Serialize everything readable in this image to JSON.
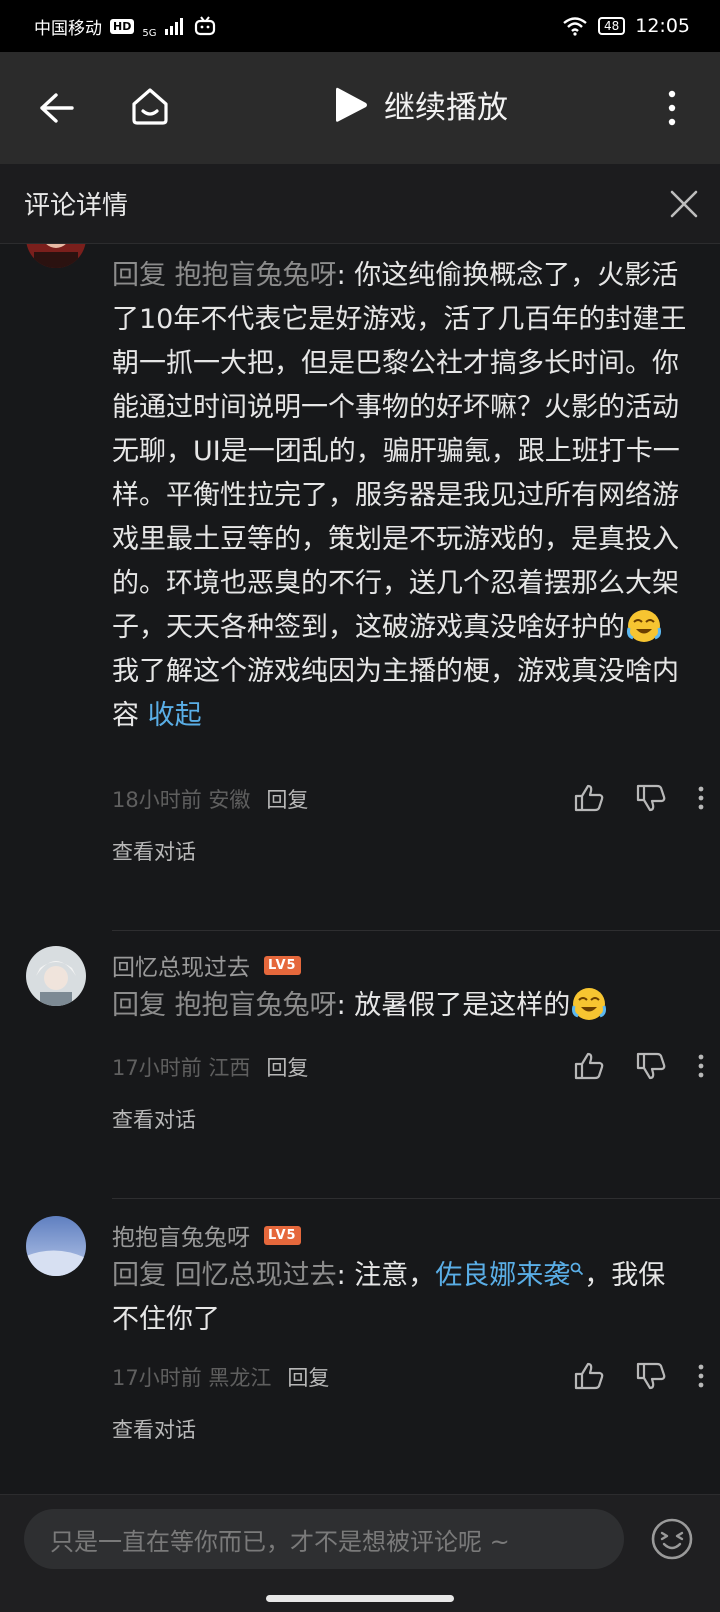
{
  "status_bar": {
    "carrier": "中国移动",
    "hd": "HD",
    "network": "5G",
    "battery": "48",
    "time": "12:05"
  },
  "top_bar": {
    "continue_label": "继续播放"
  },
  "detail_header": {
    "title": "评论详情"
  },
  "comments": [
    {
      "reply_prefix": "回复 ",
      "reply_target": "抱抱盲兔兔呀",
      "text_1": ": 你这纯偷换概念了，火影活了10年不代表它是好游戏，活了几百年的封建王朝一抓一大把，但是巴黎公社才搞多长时间。你能通过时间说明一个事物的好坏嘛？火影的活动无聊，UI是一团乱的，骗肝骗氪，跟上班打卡一样。平衡性拉完了，服务器是我见过所有网络游戏里最土豆等的，策划是不玩游戏的，是真投入的。环境也恶臭的不行，送几个忍着摆那么大架子，天天各种签到，这破游戏真没啥好护的",
      "text_2": "我了解这个游戏纯因为主播的梗，游戏真没啥内容",
      "collapse": "收起",
      "time_location": "18小时前 安徽",
      "reply_label": "回复",
      "view_conversation": "查看对话"
    },
    {
      "username": "回忆总现过去",
      "level": "LV5",
      "reply_prefix": "回复 ",
      "reply_target": "抱抱盲兔兔呀",
      "text_1": ": 放暑假了是这样的",
      "time_location": "17小时前 江西",
      "reply_label": "回复",
      "view_conversation": "查看对话"
    },
    {
      "username": "抱抱盲兔兔呀",
      "level": "LV5",
      "reply_prefix": "回复 ",
      "reply_target": "回忆总现过去",
      "text_1": ": 注意，",
      "mention": "佐良娜来袭",
      "text_2": "，我保不住你了",
      "time_location": "17小时前 黑龙江",
      "reply_label": "回复",
      "view_conversation": "查看对话"
    }
  ],
  "bottom_bar": {
    "input_placeholder": "只是一直在等你而已，才不是想被评论呢 ~"
  },
  "colors": {
    "background": "#17181a",
    "link": "#5aaee6",
    "level_badge": "#e5683c"
  }
}
